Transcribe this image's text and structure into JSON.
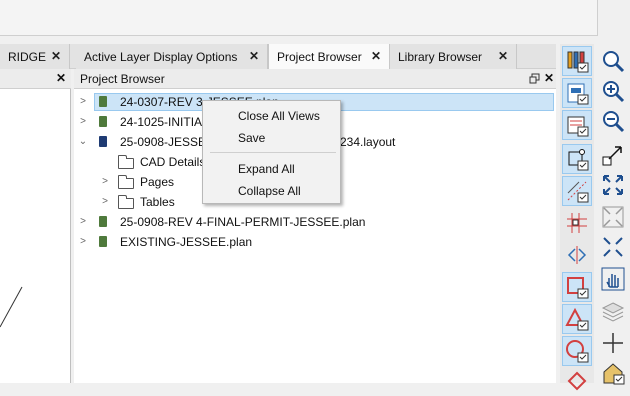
{
  "tabs": [
    {
      "label": "RIDGE",
      "close": "✕"
    },
    {
      "label": "Active Layer Display Options",
      "close": "✕"
    },
    {
      "label": "Project Browser",
      "close": "✕",
      "active": true
    },
    {
      "label": "Library Browser",
      "close": "✕"
    }
  ],
  "left_panel": {
    "close": "✕"
  },
  "project_browser": {
    "title": "Project Browser",
    "float_icon": "restore-window-icon",
    "close": "✕",
    "tree": [
      {
        "label": "24-0307-REV 3-JESSEE.plan",
        "visible_label": "24-0307-REV 3-JESSEE.plan",
        "type": "plan",
        "expanded": false,
        "selected": true
      },
      {
        "label": "24-1025-INITIAL",
        "type": "plan",
        "expanded": false
      },
      {
        "label": "25-0908-JESSEE-",
        "label_tail": "234.layout",
        "type": "layout",
        "expanded": true,
        "children": [
          {
            "label": "CAD Details",
            "type": "folder",
            "expandable": false
          },
          {
            "label": "Pages",
            "type": "folder",
            "expandable": true
          },
          {
            "label": "Tables",
            "type": "folder",
            "expandable": true
          }
        ]
      },
      {
        "label": "25-0908-REV 4-FINAL-PERMIT-JESSEE.plan",
        "type": "plan",
        "expanded": false
      },
      {
        "label": "EXISTING-JESSEE.plan",
        "type": "plan",
        "expanded": false
      }
    ]
  },
  "context_menu": {
    "items": [
      "Close All Views",
      "Save",
      "Expand All",
      "Collapse All"
    ]
  },
  "toolbar_right_1": [
    "layer-display-icon",
    "layout-sheets-icon",
    "page-setup-icon",
    "edit-area-icon",
    "dimension-icon",
    "grid-snap-icon",
    "mirror-icon",
    "box-select-icon",
    "polygon-select-icon",
    "circle-select-icon",
    "diamond-select-icon"
  ],
  "toolbar_right_2": [
    "zoom-icon",
    "zoom-in-icon",
    "zoom-out-icon",
    "undo-zoom-icon",
    "fill-window-icon",
    "fill-window-building-icon",
    "fit-to-window-icon",
    "pan-hand-icon",
    "layers-stack-icon",
    "crosshair-icon",
    "house-view-icon"
  ],
  "colors": {
    "selection": "#cce4f7",
    "selection_border": "#99c9ef",
    "plan_icon": "#4f7a3c",
    "layout_icon": "#1f3b73"
  }
}
